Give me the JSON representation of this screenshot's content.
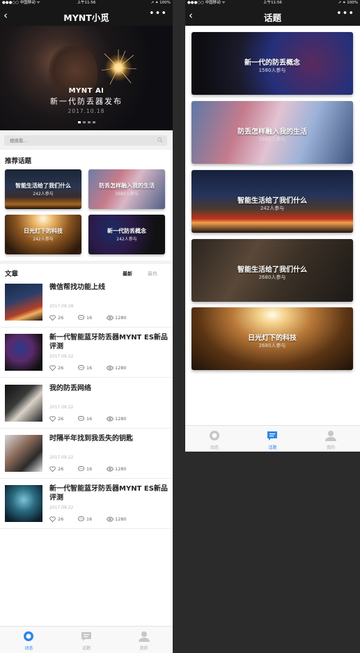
{
  "status": {
    "carrier": "●●●○○ 中国移动 ᯤ",
    "time": "上午11:56",
    "battery": "➚ ⁕ 100%"
  },
  "colors": {
    "accent": "#2f86e6",
    "text": "#222222",
    "muted": "#b5b5b5"
  },
  "left": {
    "nav": {
      "back": "‹",
      "title": "MYNT小觅",
      "more": "•••"
    },
    "hero": {
      "brand": "MYNT AI",
      "subtitle": "新一代防丢器发布",
      "date": "2017.10.18"
    },
    "search": {
      "placeholder": "搜搜看..."
    },
    "recommend": {
      "title": "推荐话题",
      "cards": [
        {
          "title": "智能生活给了我们什么",
          "count": "242人参与"
        },
        {
          "title": "防丢怎样融入我的生活",
          "count": "2680人参与"
        },
        {
          "title": "日光灯下的科技",
          "count": "242人参与"
        },
        {
          "title": "新一代防丢概念",
          "count": "242人参与"
        }
      ]
    },
    "articles_header": {
      "title": "文章",
      "tab_latest": "最新",
      "tab_hot": "最热"
    },
    "articles": [
      {
        "title": "微信帮找功能上线",
        "date": "2017.09.28",
        "likes": "26",
        "comments": "16",
        "views": "1280"
      },
      {
        "title": "新一代智能蓝牙防丢器MYNT ES新品评测",
        "date": "2017.09.22",
        "likes": "26",
        "comments": "16",
        "views": "1280"
      },
      {
        "title": "我的防丢网络",
        "date": "2017.09.22",
        "likes": "26",
        "comments": "16",
        "views": "1280"
      },
      {
        "title": "时隔半年找到我丢失的钥匙",
        "date": "2017.09.22",
        "likes": "26",
        "comments": "16",
        "views": "1280"
      },
      {
        "title": "新一代智能蓝牙防丢器MYNT ES新品评测",
        "date": "2017.09.22",
        "likes": "26",
        "comments": "16",
        "views": "1280"
      }
    ],
    "tabbar": [
      "动态",
      "话题",
      "我的"
    ]
  },
  "right": {
    "nav": {
      "back": "‹",
      "title": "话题",
      "more": "•••"
    },
    "topics": [
      {
        "title": "新一代的防丢概念",
        "count": "1580人参与"
      },
      {
        "title": "防丢怎样融入我的生活",
        "count": "2680人参与"
      },
      {
        "title": "智能生活给了我们什么",
        "count": "242人参与"
      },
      {
        "title": "智能生活给了我们什么",
        "count": "2680人参与"
      },
      {
        "title": "日光灯下的科技",
        "count": "2680人参与"
      }
    ],
    "tabbar": [
      "动态",
      "话题",
      "我的"
    ]
  }
}
